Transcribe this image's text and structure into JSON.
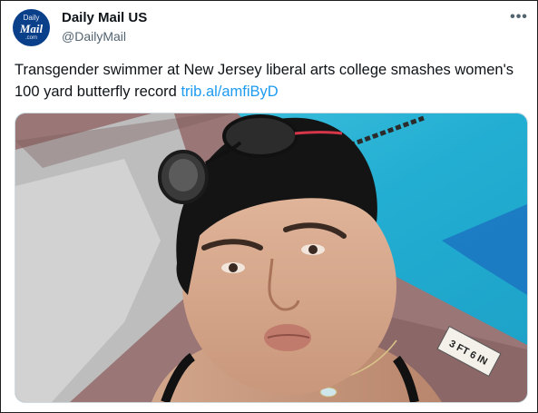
{
  "tweet": {
    "author_name": "Daily Mail US",
    "author_handle": "@DailyMail",
    "avatar_lines": [
      "Daily",
      "Mail",
      ".com"
    ],
    "more_label": "•••",
    "text": "Transgender swimmer at New Jersey liberal arts college smashes women's 100 yard butterfly record",
    "link": "trib.al/amfiByD"
  },
  "media": {
    "description_icon": "photo",
    "pool_marking": "3 FT 6 IN"
  },
  "colors": {
    "link": "#1d9bf0",
    "text": "#0f1419",
    "secondary": "#536471",
    "avatar_bg": "#0a3f8a",
    "pool_water": "#2ab7d8"
  }
}
